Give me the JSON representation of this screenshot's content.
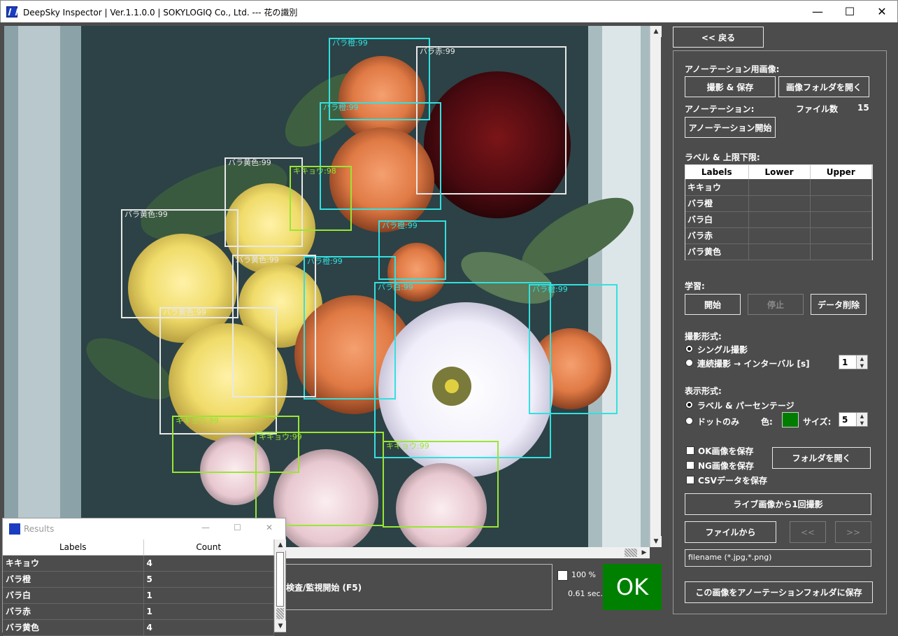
{
  "window": {
    "title": "DeepSky Inspector | Ver.1.1.0.0 | SOKYLOGIQ Co., Ltd. --- 花の識別",
    "minimize": "—",
    "maximize": "☐",
    "close": "✕"
  },
  "detections": [
    {
      "label": "バラ橙:99",
      "color": "#33e0e0"
    },
    {
      "label": "バラ赤:99",
      "color": "#e8e8e8"
    },
    {
      "label": "バラ橙:99",
      "color": "#33e0e0"
    },
    {
      "label": "バラ黄色:99",
      "color": "#e8e8e8"
    },
    {
      "label": "キキョウ:98",
      "color": "#99e633"
    },
    {
      "label": "バラ黄色:99",
      "color": "#e8e8e8"
    },
    {
      "label": "バラ橙:99",
      "color": "#33e0e0"
    },
    {
      "label": "バラ黄色:99",
      "color": "#e8e8e8"
    },
    {
      "label": "バラ橙:99",
      "color": "#33e0e0"
    },
    {
      "label": "バラ白:99",
      "color": "#33e0e0"
    },
    {
      "label": "バラ橙:99",
      "color": "#33e0e0"
    },
    {
      "label": "バラ黄色:99",
      "color": "#e8e8e8"
    },
    {
      "label": "キキョウ:99",
      "color": "#99e633"
    },
    {
      "label": "キキョウ:99",
      "color": "#99e633"
    },
    {
      "label": "キキョウ:99",
      "color": "#99e633"
    }
  ],
  "panel": {
    "back_label": "<< 戻る",
    "annotation_image_label": "アノーテーション用画像:",
    "capture_save": "撮影 & 保存",
    "open_image_folder": "画像フォルダを開く",
    "annotation_label": "アノーテーション:",
    "file_count_label": "ファイル数",
    "file_count": "15",
    "start_annotation": "アノーテーション開始",
    "label_limits_label": "ラベル & 上限下限:",
    "label_columns": [
      "Labels",
      "Lower",
      "Upper"
    ],
    "label_rows": [
      "キキョウ",
      "バラ橙",
      "バラ白",
      "バラ赤",
      "バラ黄色"
    ],
    "learning_label": "学習:",
    "learn_start": "開始",
    "learn_stop": "停止",
    "delete_data": "データ削除",
    "capture_format_label": "撮影形式:",
    "single_capture": "シングル撮影",
    "continuous_capture": "連続撮影 → インターバル [s]",
    "interval_value": "1",
    "display_format_label": "表示形式:",
    "label_percentage": "ラベル & パーセンテージ",
    "dots_only": "ドットのみ",
    "color_label": "色:",
    "dot_color": "#007d00",
    "size_label": "サイズ:",
    "size_value": "5",
    "save_ok": "OK画像を保存",
    "save_ng": "NG画像を保存",
    "save_csv": "CSVデータを保存",
    "open_folder": "フォルダを開く",
    "capture_once_live": "ライブ画像から1回撮影",
    "from_file": "ファイルから",
    "prev": "<<",
    "next": ">>",
    "filename_placeholder": "filename (*.jpg,*.png)",
    "save_to_annotation": "この画像をアノーテーションフォルダに保存"
  },
  "results": {
    "title": "Results",
    "minimize": "—",
    "maximize": "☐",
    "close": "✕",
    "columns": [
      "Labels",
      "Count"
    ],
    "rows": [
      {
        "label": "キキョウ",
        "count": "4"
      },
      {
        "label": "バラ橙",
        "count": "5"
      },
      {
        "label": "バラ白",
        "count": "1"
      },
      {
        "label": "バラ赤",
        "count": "1"
      },
      {
        "label": "バラ黄色",
        "count": "4"
      }
    ]
  },
  "status": {
    "start_inspection": "検査/監視開始 (F5)",
    "zoom": "100 %",
    "elapsed": "0.61 sec.",
    "verdict": "OK",
    "verdict_color": "#008000"
  }
}
